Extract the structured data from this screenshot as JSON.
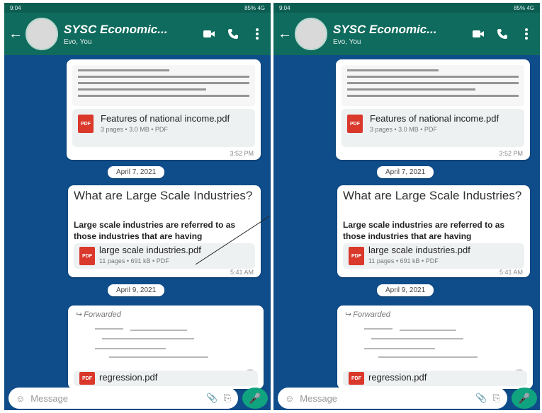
{
  "status": {
    "time": "9:04",
    "right": "85% 4G"
  },
  "chat": {
    "title": "SYSC Economic...",
    "subtitle": "Evo, You"
  },
  "messages": {
    "doc1": {
      "name": "Features of national income.pdf",
      "meta": "3 pages • 3.0 MB • PDF",
      "time": "3:52 PM"
    },
    "date1": "April 7, 2021",
    "text1": {
      "title": "What are Large Scale Industries?",
      "body": "Large scale industries are referred to as those industries that are having",
      "doc_name": "large scale industries.pdf",
      "doc_meta": "11 pages • 691 kB • PDF",
      "time": "5:41 AM"
    },
    "date2": "April 9, 2021",
    "forward": {
      "label": "Forwarded",
      "doc_name": "regression.pdf"
    }
  },
  "composer": {
    "placeholder": "Message"
  },
  "icons": {
    "back": "arrow-left-icon",
    "video": "video-icon",
    "call": "phone-icon",
    "more": "more-vertical-icon",
    "attach": "paperclip-icon",
    "camera": "camera-icon",
    "emoji": "emoji-icon",
    "mic": "mic-icon"
  }
}
